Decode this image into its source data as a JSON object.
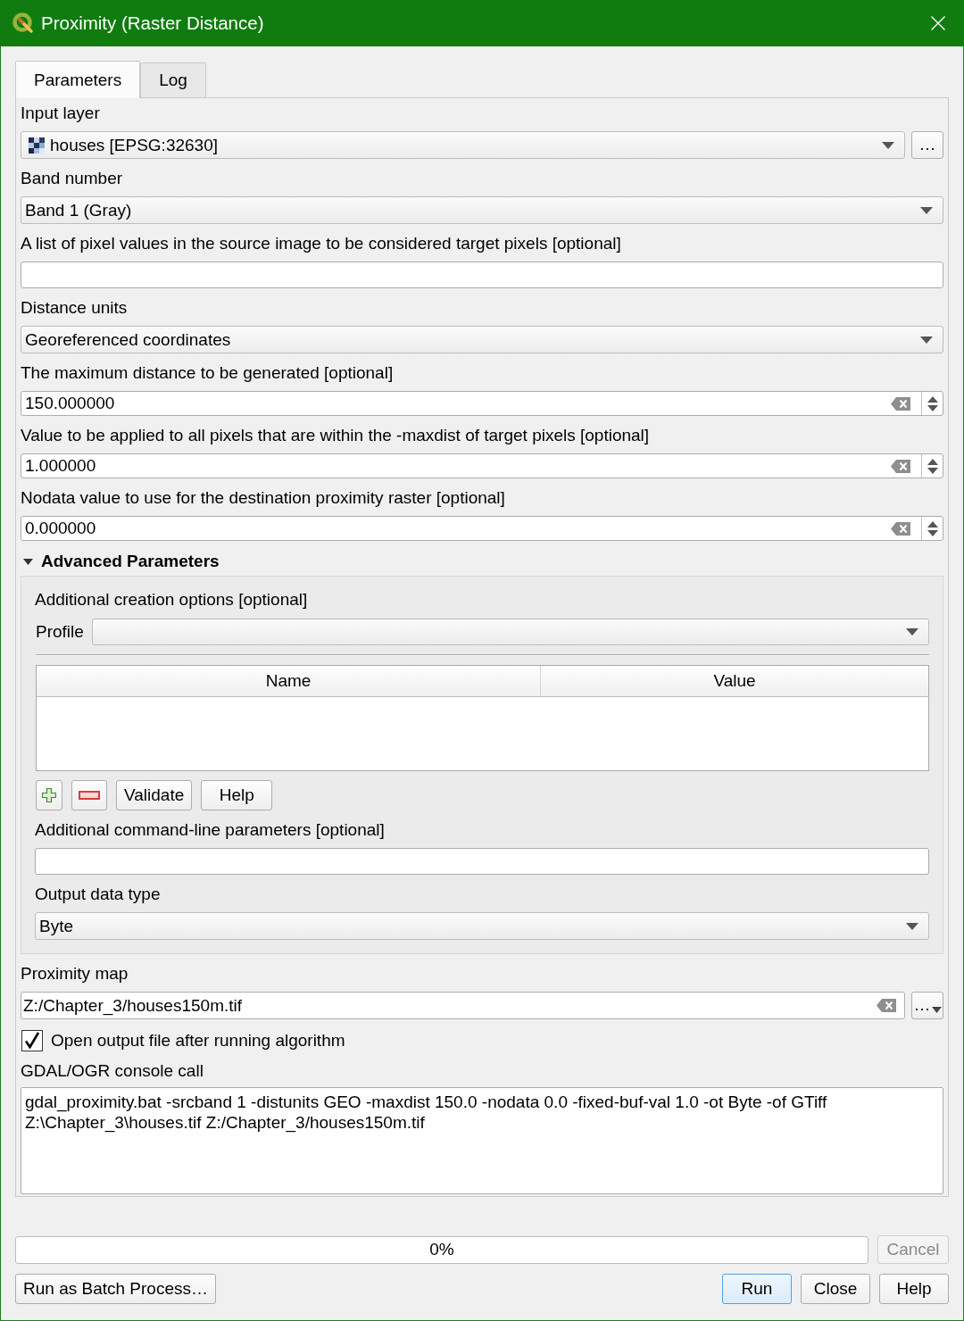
{
  "window": {
    "title": "Proximity (Raster Distance)"
  },
  "tabs": [
    {
      "label": "Parameters",
      "selected": true
    },
    {
      "label": "Log",
      "selected": false
    }
  ],
  "parameters": [
    {
      "kind": "layer",
      "label": "Input layer",
      "value": "houses [EPSG:32630]",
      "button": "…"
    },
    {
      "kind": "combo",
      "label": "Band number",
      "value": "Band 1 (Gray)"
    },
    {
      "kind": "text",
      "label": "A list of pixel values in the source image to be considered target pixels [optional]"
    },
    {
      "kind": "combo",
      "label": "Distance units",
      "value": "Georeferenced coordinates"
    },
    {
      "kind": "number",
      "label": "The maximum distance to be generated [optional]",
      "value": "150.000000"
    },
    {
      "kind": "number",
      "label": "Value to be applied to all pixels that are within the -maxdist of target pixels [optional]",
      "value": "1.000000"
    },
    {
      "kind": "number",
      "label": "Nodata value to use for the destination proximity raster [optional]",
      "value": "0.000000"
    }
  ],
  "advanced": {
    "title": "Advanced Parameters",
    "expanded": true,
    "creation_options": {
      "label": "Additional creation options [optional]",
      "profile_label": "Profile",
      "columns": [
        "Name",
        "Value"
      ],
      "buttons": [
        "Validate",
        "Help"
      ]
    },
    "parameters": [
      {
        "kind": "text",
        "label": "Additional command-line parameters [optional]"
      },
      {
        "kind": "combo",
        "label": "Output data type",
        "value": "Byte"
      }
    ]
  },
  "output": {
    "kind": "file",
    "label": "Proximity map",
    "value": "Z:/Chapter_3/houses150m.tif",
    "button": "…"
  },
  "open_output": {
    "label": "Open output file after running algorithm",
    "checked": true
  },
  "console": {
    "label": "GDAL/OGR console call",
    "text": "gdal_proximity.bat -srcband 1 -distunits GEO -maxdist 150.0 -nodata 0.0 -fixed-buf-val 1.0 -ot Byte -of GTiff Z:\\Chapter_3\\houses.tif Z:/Chapter_3/houses150m.tif"
  },
  "progress": {
    "level": 0,
    "text": "0%"
  },
  "cancel_button": {
    "label": "Cancel",
    "disabled": true
  },
  "batch_button": "Run as Batch Process…",
  "buttons": [
    {
      "label": "Run",
      "default": true
    },
    {
      "label": "Close",
      "default": false
    },
    {
      "label": "Help",
      "default": false
    }
  ]
}
